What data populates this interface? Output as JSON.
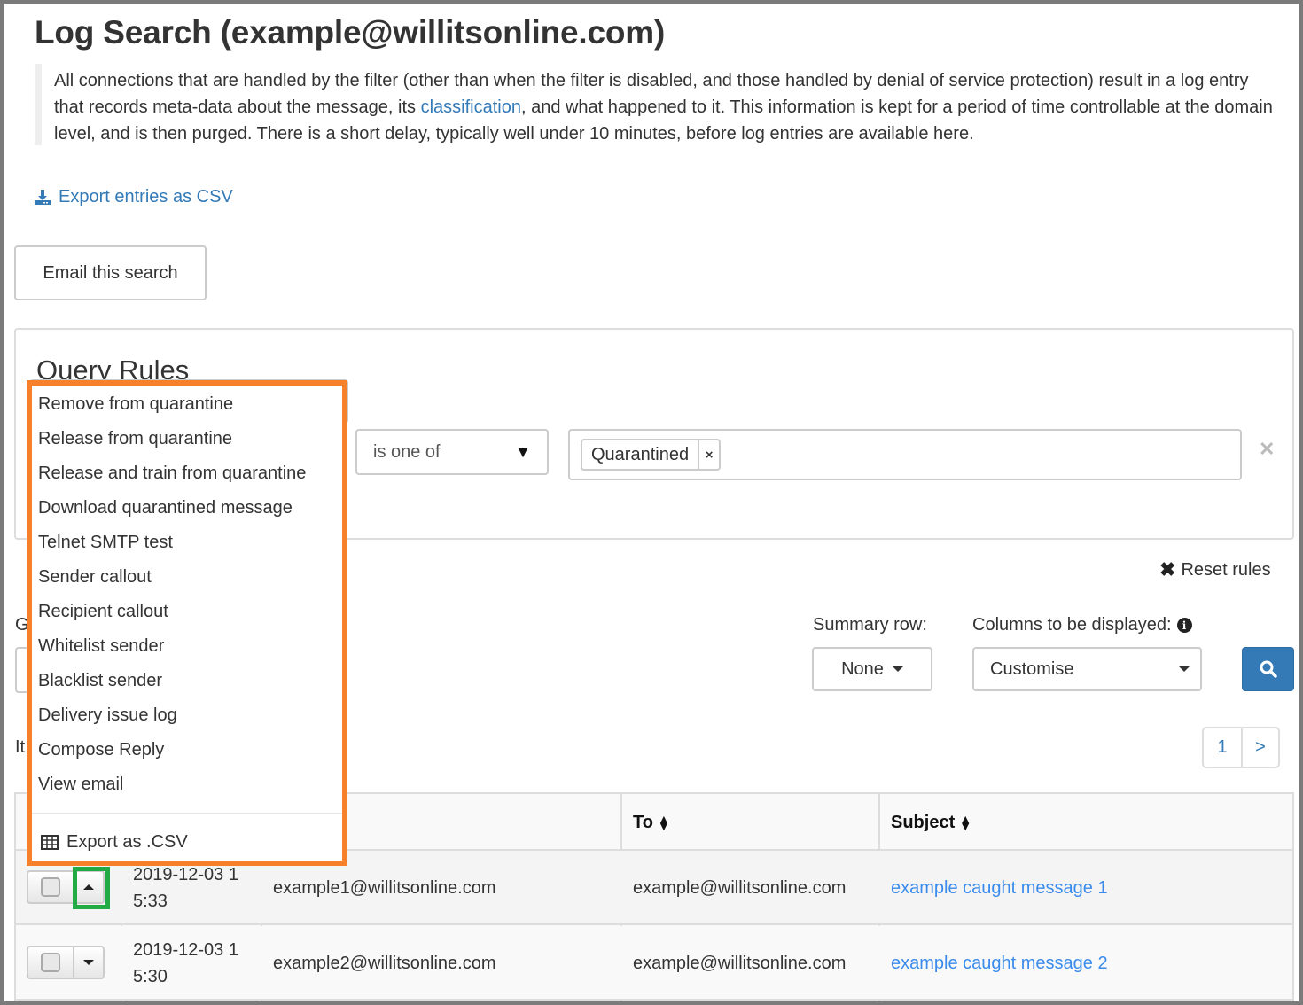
{
  "page": {
    "title": "Log Search (example@willitsonline.com)",
    "intro": {
      "before_link": "All connections that are handled by the filter (other than when the filter is disabled, and those handled by denial of service protection) result in a log entry that records meta-data about the message, its ",
      "link": "classification",
      "after_link": ", and what happened to it. This information is kept for a period of time controllable at the domain level, and is then purged. There is a short delay, typically well under 10 minutes, before log entries are available here."
    },
    "export_csv_link": "Export entries as CSV",
    "email_search_button": "Email this search"
  },
  "query_rules": {
    "title": "Query Rules",
    "operator": "is one of",
    "tags": [
      {
        "label": "Quarantined",
        "remove": "×"
      }
    ],
    "remove_rule": "✕",
    "reset_rules": "Reset rules"
  },
  "options": {
    "group_label_partial": "G",
    "items_label_partial": "It",
    "summary_row_label": "Summary row:",
    "summary_row_value": "None",
    "columns_label": "Columns to be displayed:",
    "columns_value": "Customise",
    "info_icon": "i"
  },
  "pagination": {
    "current": "1",
    "next": ">"
  },
  "table": {
    "headers": {
      "to": "To",
      "subject": "Subject"
    },
    "rows": [
      {
        "date_line1": "2019-12-03 1",
        "date_line2": "5:33",
        "from": "example1@willitsonline.com",
        "to": "example@willitsonline.com",
        "subject": "example caught message 1",
        "menu_open": true
      },
      {
        "date_line1": "2019-12-03 1",
        "date_line2": "5:30",
        "from": "example2@willitsonline.com",
        "to": "example@willitsonline.com",
        "subject": "example caught message 2",
        "menu_open": false
      }
    ]
  },
  "action_menu": {
    "items": [
      "Remove from quarantine",
      "Release from quarantine",
      "Release and train from quarantine",
      "Download quarantined message",
      "Telnet SMTP test",
      "Sender callout",
      "Recipient callout",
      "Whitelist sender",
      "Blacklist sender",
      "Delivery issue log",
      "Compose Reply",
      "View email"
    ],
    "export_label": "Export as .CSV"
  },
  "colors": {
    "link": "#337ab7",
    "subject_link": "#3b8beb",
    "primary_button": "#337ab7",
    "menu_highlight": "#f7812b",
    "toggle_highlight": "#22aa44"
  }
}
